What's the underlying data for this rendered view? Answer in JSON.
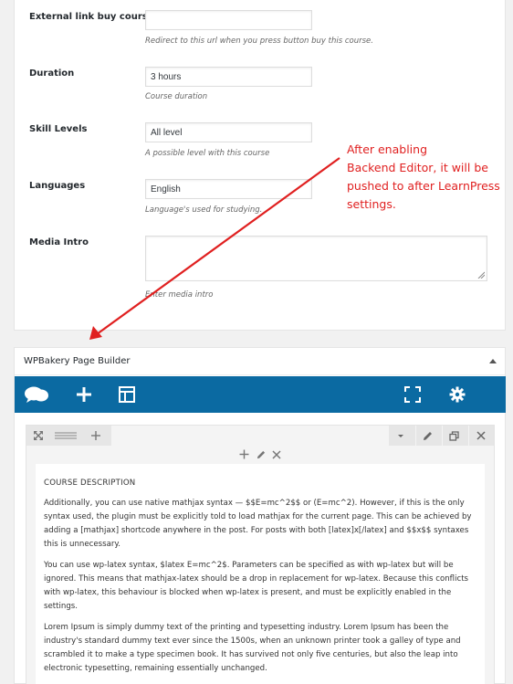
{
  "course_settings": {
    "fields": [
      {
        "label": "External link buy course",
        "value": "",
        "description": "Redirect to this url when you press button buy this course."
      },
      {
        "label": "Duration",
        "value": "3 hours",
        "description": "Course duration"
      },
      {
        "label": "Skill Levels",
        "value": "All level",
        "description": "A possible level with this course"
      },
      {
        "label": "Languages",
        "value": "English",
        "description": "Language's used for studying."
      },
      {
        "label": "Media Intro",
        "value": "",
        "description": "Enter media intro"
      }
    ]
  },
  "annotation": {
    "text_lines": [
      "After enabling",
      "Backend Editor, it will be",
      "pushed to after LearnPress",
      "settings."
    ],
    "color": "#e02020"
  },
  "wpbakery": {
    "title": "WPBakery Page Builder",
    "toolbar_color": "#0b6aa2",
    "toolbar_icons": [
      "chat-bubbles-icon",
      "plus-icon",
      "layout-template-icon",
      "fullscreen-icon",
      "gear-icon"
    ],
    "content": {
      "heading": "COURSE DESCRIPTION",
      "paragraphs": [
        "Additionally, you can use native mathjax syntax — $$E=mc^2$$ or (E=mc^2). However, if this is the only syntax used, the plugin must be explicitly told to load mathjax for the current page. This can be achieved by adding a [mathjax] shortcode anywhere in the post. For posts with both [latex]x[/latex] and $$x$$ syntaxes this is unnecessary.",
        "You can use wp-latex syntax, $latex E=mc^2$. Parameters can be specified as with wp-latex but will be ignored. This means that mathjax-latex should be a drop in replacement for wp-latex. Because this conflicts with wp-latex, this behaviour is blocked when wp-latex is present, and must be explicitly enabled in the settings.",
        "Lorem Ipsum is simply dummy text of the printing and typesetting industry. Lorem Ipsum has been the industry's standard dummy text ever since the 1500s, when an unknown printer took a galley of type and scrambled it to make a type specimen book. It has survived not only five centuries, but also the leap into electronic typesetting, remaining essentially unchanged."
      ]
    }
  }
}
